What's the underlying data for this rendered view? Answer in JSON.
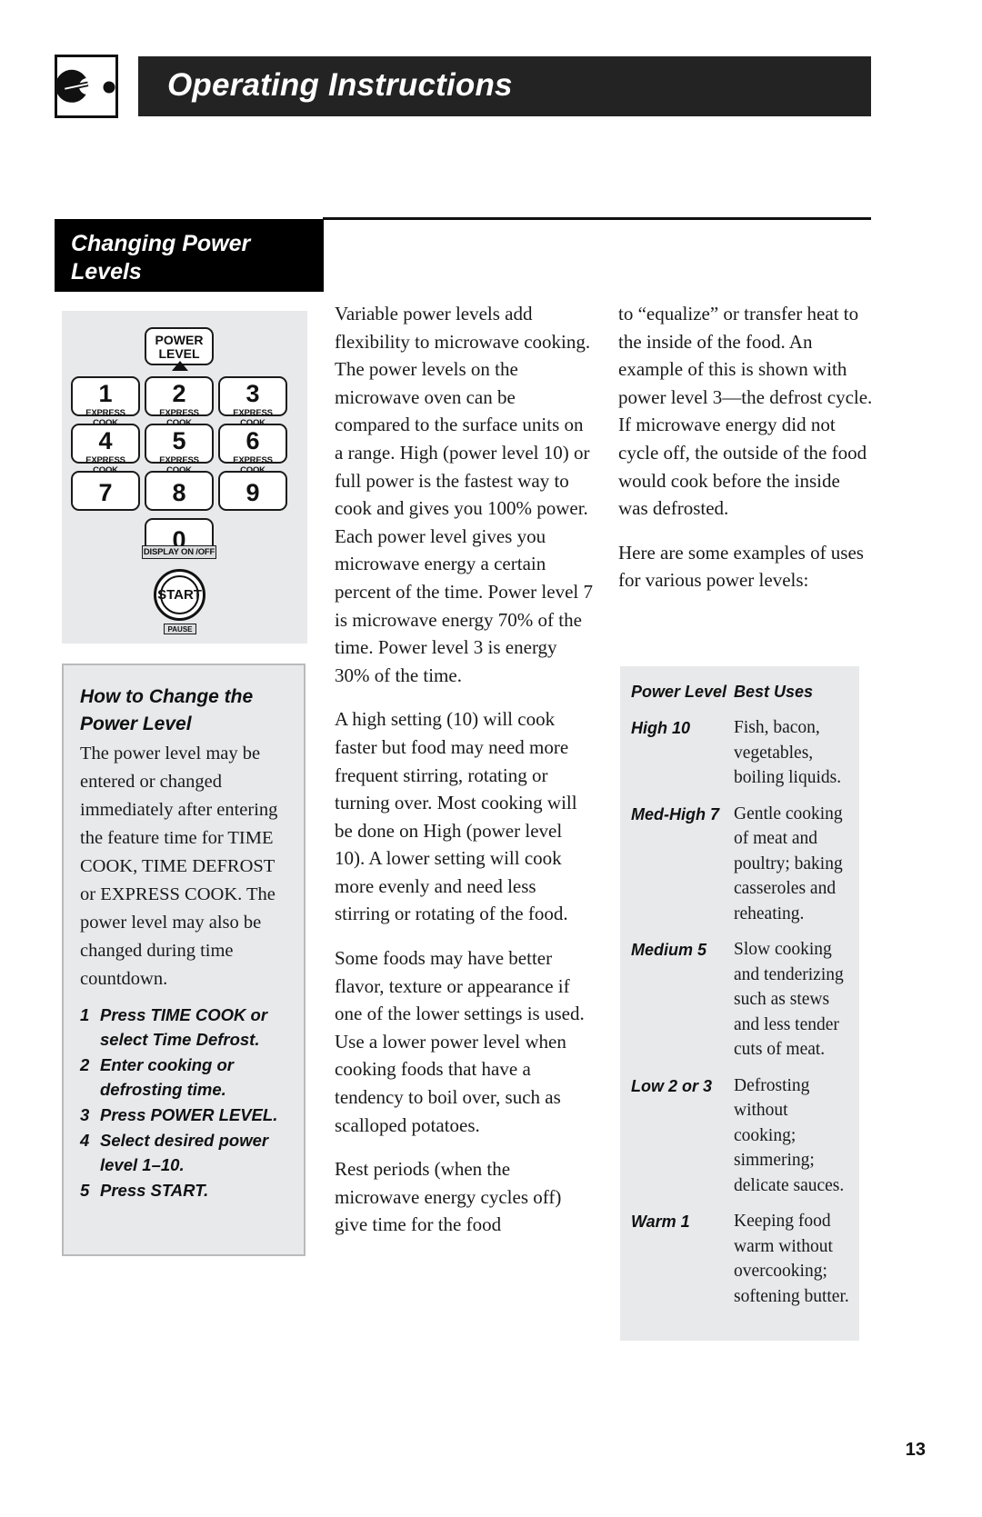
{
  "header": {
    "title": "Operating Instructions",
    "icon": "microwave-dial-icon"
  },
  "section": {
    "title_line1": "Changing Power",
    "title_line2": "Levels"
  },
  "keypad": {
    "power_level_line1": "POWER",
    "power_level_line2": "LEVEL",
    "express_cook_label": "EXPRESS COOK",
    "keys": [
      {
        "num": "1",
        "sub": "EXPRESS COOK"
      },
      {
        "num": "2",
        "sub": "EXPRESS COOK"
      },
      {
        "num": "3",
        "sub": "EXPRESS COOK"
      },
      {
        "num": "4",
        "sub": "EXPRESS COOK"
      },
      {
        "num": "5",
        "sub": "EXPRESS COOK"
      },
      {
        "num": "6",
        "sub": "EXPRESS COOK"
      },
      {
        "num": "7",
        "sub": ""
      },
      {
        "num": "8",
        "sub": ""
      },
      {
        "num": "9",
        "sub": ""
      }
    ],
    "zero": "0",
    "display_on_off": "DISPLAY ON /OFF",
    "start": "START",
    "pause": "PAUSE"
  },
  "howto": {
    "title_line1": "How to Change the",
    "title_line2": "Power Level",
    "body": "The power level may be entered or changed immediately after entering the feature time for TIME COOK, TIME DEFROST or EXPRESS COOK. The power level may also be changed during time countdown.",
    "steps": [
      {
        "n": "1",
        "text": "Press TIME COOK or select Time Defrost."
      },
      {
        "n": "2",
        "text": "Enter cooking or defrosting time."
      },
      {
        "n": "3",
        "text": "Press POWER LEVEL."
      },
      {
        "n": "4",
        "text": "Select desired power level 1–10."
      },
      {
        "n": "5",
        "text": "Press START."
      }
    ]
  },
  "column2": {
    "p1": "Variable power levels add flexibility to microwave cooking. The power levels on the microwave oven can be compared to the surface units on a range. High (power level 10) or full power is the fastest way to cook and gives you 100% power. Each power level gives you microwave energy a certain percent of the time. Power level 7 is microwave energy 70% of the time. Power level 3 is energy 30% of the time.",
    "p2": "A high setting (10) will cook faster but food may need more frequent stirring, rotating or turning over. Most cooking will be done on High (power level 10). A lower setting will cook more evenly and need less stirring or rotating of the food.",
    "p3": "Some foods may have better flavor, texture or appearance if one of the lower settings is used. Use a lower power level when cooking foods that have a tendency to boil over, such as scalloped potatoes.",
    "p4": "Rest periods (when the microwave energy cycles off) give time for the food"
  },
  "column3": {
    "p1": "to “equalize” or transfer heat to the inside of the food. An example of this is shown with power level 3—the defrost cycle. If microwave energy did not cycle off, the outside of the food would cook before the inside was defrosted.",
    "p2": "Here are some examples of uses for various power levels:"
  },
  "power_table": {
    "header": {
      "level": "Power Level",
      "uses": "Best Uses"
    },
    "rows": [
      {
        "level": "High 10",
        "uses": "Fish, bacon, vegetables, boiling liquids."
      },
      {
        "level": "Med-High 7",
        "uses": "Gentle cooking of meat and poultry; baking casseroles and reheating."
      },
      {
        "level": "Medium 5",
        "uses": "Slow cooking and tenderizing such as stews and less tender cuts of  meat."
      },
      {
        "level": "Low 2 or 3",
        "uses": "Defrosting without cooking; simmering; delicate sauces."
      },
      {
        "level": "Warm 1",
        "uses": "Keeping food warm without overcooking; softening butter."
      }
    ]
  },
  "footer": {
    "page_number": "13"
  },
  "colors": {
    "header_bar": "#232323",
    "section_box": "#000000",
    "panel_gray": "#e8e9ea",
    "text": "#1a1a1a"
  }
}
